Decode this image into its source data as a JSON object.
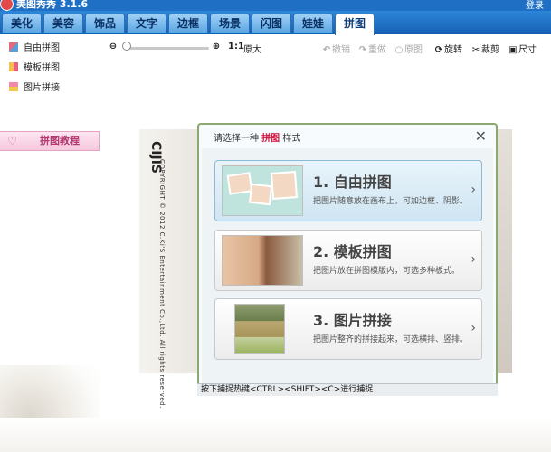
{
  "window": {
    "title": "美图秀秀 3.1.6",
    "login": "登录"
  },
  "tabs": [
    {
      "label": "美化",
      "active": false
    },
    {
      "label": "美容",
      "active": false
    },
    {
      "label": "饰品",
      "active": false
    },
    {
      "label": "文字",
      "active": false
    },
    {
      "label": "边框",
      "active": false
    },
    {
      "label": "场景",
      "active": false
    },
    {
      "label": "闪图",
      "active": false
    },
    {
      "label": "娃娃",
      "active": false
    },
    {
      "label": "拼图",
      "active": true
    }
  ],
  "sidebar": {
    "items": [
      {
        "label": "自由拼图",
        "icon": "free-collage-icon"
      },
      {
        "label": "模板拼图",
        "icon": "template-collage-icon"
      },
      {
        "label": "图片拼接",
        "icon": "photo-join-icon"
      }
    ],
    "tutorial": "拼图教程"
  },
  "toolbar": {
    "ratio": "1:1",
    "original_size": "原大",
    "undo": "撤销",
    "redo": "重做",
    "original": "原图",
    "rotate": "旋转",
    "crop": "裁剪",
    "size": "尺寸"
  },
  "poster": {
    "logo": "CIJIS",
    "copyright": "COPYRIGHT © 2012 C.Ki'S Entertainment Co.,Ltd. All rights reserved."
  },
  "dialog": {
    "title_prefix": "请选择一种",
    "title_keyword": "拼图",
    "title_suffix": "样式",
    "options": [
      {
        "title": "1. 自由拼图",
        "desc": "把图片随意放在画布上，可加边框、阴影。",
        "selected": true
      },
      {
        "title": "2. 模板拼图",
        "desc": "把图片放在拼图模版内，可选多种板式。",
        "selected": false
      },
      {
        "title": "3. 图片拼接",
        "desc": "把图片整齐的拼接起来，可选横排、竖排。",
        "selected": false
      }
    ]
  },
  "status_bar": "按下捕捉热键<CTRL><SHIFT><C>进行捕捉",
  "colors": {
    "accent": "#1f6fc4",
    "keyword": "#d20f3a",
    "tutorial": "#b2386f"
  }
}
